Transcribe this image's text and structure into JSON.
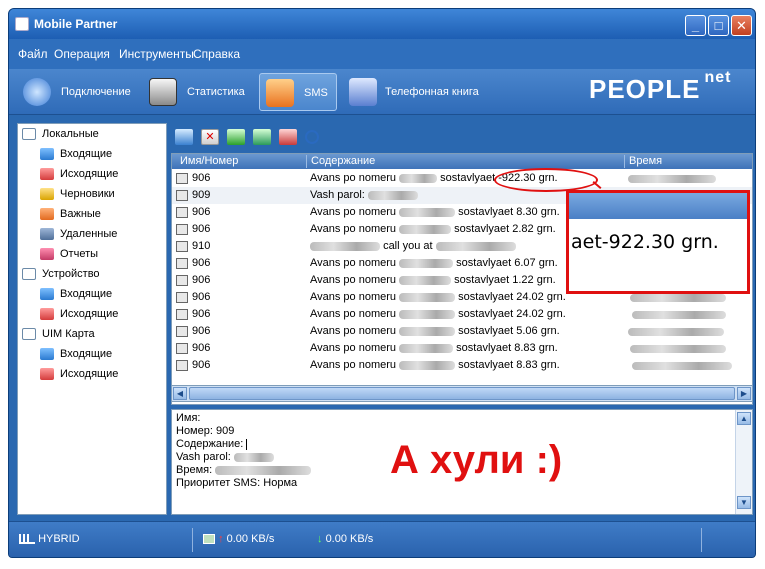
{
  "window": {
    "title": "Mobile Partner"
  },
  "menu": [
    "Файл",
    "Операция",
    "Инструменты",
    "Справка"
  ],
  "nav": [
    {
      "label": "Подключение",
      "icon": "connect-icon"
    },
    {
      "label": "Статистика",
      "icon": "statistics-icon"
    },
    {
      "label": "SMS",
      "icon": "sms-icon"
    },
    {
      "label": "Телефонная книга",
      "icon": "phonebook-icon"
    }
  ],
  "brand": {
    "text": "PEOPLE",
    "sup": "net"
  },
  "sidebar": {
    "local": "Локальные",
    "inbox": "Входящие",
    "outbox": "Исходящие",
    "drafts": "Черновики",
    "important": "Важные",
    "deleted": "Удаленные",
    "reports": "Отчеты",
    "device": "Устройство",
    "device_inbox": "Входящие",
    "device_outbox": "Исходящие",
    "uim": "UIM Карта",
    "uim_inbox": "Входящие",
    "uim_outbox": "Исходящие"
  },
  "toolbar_icons": [
    "new-message-icon",
    "delete-icon",
    "reply-icon",
    "forward-icon",
    "resend-icon",
    "search-icon"
  ],
  "list": {
    "headers": {
      "name": "Имя/Номер",
      "content": "Содержание",
      "time": "Время"
    },
    "rows": [
      {
        "num": "906",
        "c1": "Avans po nomeru",
        "c2": "sostavlyaet -922.30 grn."
      },
      {
        "num": "909",
        "c1": "Vash parol:",
        "c2": ""
      },
      {
        "num": "906",
        "c1": "Avans po nomeru",
        "c2": "sostavlyaet 8.30 grn."
      },
      {
        "num": "906",
        "c1": "Avans po nomeru",
        "c2": "sostavlyaet 2.82 grn."
      },
      {
        "num": "910",
        "c1": "",
        "c2": "call you at"
      },
      {
        "num": "906",
        "c1": "Avans po nomeru",
        "c2": "sostavlyaet 6.07 grn."
      },
      {
        "num": "906",
        "c1": "Avans po nomeru",
        "c2": "sostavlyaet 1.22 grn."
      },
      {
        "num": "906",
        "c1": "Avans po nomeru",
        "c2": "sostavlyaet 24.02 grn."
      },
      {
        "num": "906",
        "c1": "Avans po nomeru",
        "c2": "sostavlyaet 24.02 grn."
      },
      {
        "num": "906",
        "c1": "Avans po nomeru",
        "c2": "sostavlyaet 5.06 grn."
      },
      {
        "num": "906",
        "c1": "Avans po nomeru",
        "c2": "sostavlyaet 8.83 grn."
      },
      {
        "num": "906",
        "c1": "Avans po nomeru",
        "c2": "sostavlyaet 8.83 grn."
      }
    ]
  },
  "detail": {
    "name": "Имя:",
    "number": "Номер: 909",
    "content": "Содержание:",
    "body": "Vash parol:",
    "time": "Время:",
    "priority": "Приоритет SMS: Норма"
  },
  "annotation": "А хули :)",
  "zoom": {
    "text": "aet-922.30 grn."
  },
  "status": {
    "network": "HYBRID",
    "upload": "0.00 KB/s",
    "download": "0.00 KB/s"
  }
}
